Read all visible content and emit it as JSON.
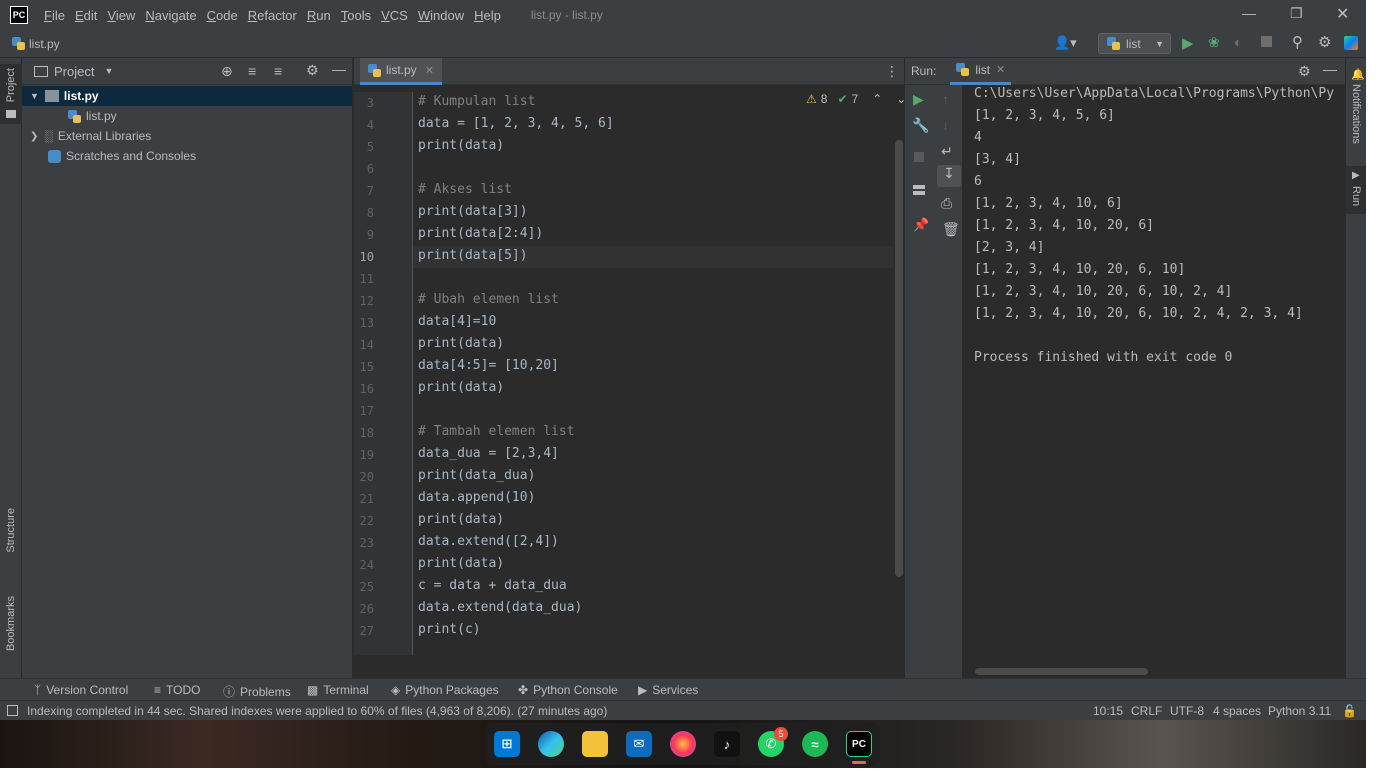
{
  "titlebar": {
    "menus": [
      "File",
      "Edit",
      "View",
      "Navigate",
      "Code",
      "Refactor",
      "Run",
      "Tools",
      "VCS",
      "Window",
      "Help"
    ],
    "window_title": "list.py - list.py"
  },
  "navbar": {
    "file": "list.py",
    "run_config": "list"
  },
  "left_stripe": {
    "project": "Project",
    "structure": "Structure",
    "bookmarks": "Bookmarks"
  },
  "project_panel": {
    "title": "Project",
    "tree": [
      {
        "label": "list.py",
        "selected": true
      },
      {
        "label": "list.py"
      },
      {
        "label": "External Libraries"
      },
      {
        "label": "Scratches and Consoles"
      }
    ]
  },
  "editor": {
    "tab": "list.py",
    "warnings": "8",
    "weak_warnings": "7",
    "current_line": 10,
    "lines": [
      {
        "n": "3",
        "text": "# Kumpulan list"
      },
      {
        "n": "4",
        "text": "data = [1, 2, 3, 4, 5, 6]"
      },
      {
        "n": "5",
        "text": "print(data)"
      },
      {
        "n": "6",
        "text": ""
      },
      {
        "n": "7",
        "text": "# Akses list"
      },
      {
        "n": "8",
        "text": "print(data[3])"
      },
      {
        "n": "9",
        "text": "print(data[2:4])"
      },
      {
        "n": "10",
        "text": "print(data[5])"
      },
      {
        "n": "11",
        "text": ""
      },
      {
        "n": "12",
        "text": "# Ubah elemen list"
      },
      {
        "n": "13",
        "text": "data[4]=10"
      },
      {
        "n": "14",
        "text": "print(data)"
      },
      {
        "n": "15",
        "text": "data[4:5]= [10,20]"
      },
      {
        "n": "16",
        "text": "print(data)"
      },
      {
        "n": "17",
        "text": ""
      },
      {
        "n": "18",
        "text": "# Tambah elemen list"
      },
      {
        "n": "19",
        "text": "data_dua = [2,3,4]"
      },
      {
        "n": "20",
        "text": "print(data_dua)"
      },
      {
        "n": "21",
        "text": "data.append(10)"
      },
      {
        "n": "22",
        "text": "print(data)"
      },
      {
        "n": "23",
        "text": "data.extend([2,4])"
      },
      {
        "n": "24",
        "text": "print(data)"
      },
      {
        "n": "25",
        "text": "c = data + data_dua"
      },
      {
        "n": "26",
        "text": "data.extend(data_dua)"
      },
      {
        "n": "27",
        "text": "print(c)"
      }
    ]
  },
  "run_panel": {
    "label": "Run:",
    "tab": "list",
    "output": [
      "C:\\Users\\User\\AppData\\Local\\Programs\\Python\\Py",
      "[1, 2, 3, 4, 5, 6]",
      "4",
      "[3, 4]",
      "6",
      "[1, 2, 3, 4, 10, 6]",
      "[1, 2, 3, 4, 10, 20, 6]",
      "[2, 3, 4]",
      "[1, 2, 3, 4, 10, 20, 6, 10]",
      "[1, 2, 3, 4, 10, 20, 6, 10, 2, 4]",
      "[1, 2, 3, 4, 10, 20, 6, 10, 2, 4, 2, 3, 4]",
      "",
      "Process finished with exit code 0"
    ]
  },
  "right_stripe": {
    "notifications": "Notifications",
    "run": "Run"
  },
  "bottom_tools": [
    "Version Control",
    "TODO",
    "Problems",
    "Terminal",
    "Python Packages",
    "Python Console",
    "Services"
  ],
  "status": {
    "message": "Indexing completed in 44 sec. Shared indexes were applied to 60% of files (4,963 of 8,206). (27 minutes ago)",
    "position": "10:15",
    "line_sep": "CRLF",
    "encoding": "UTF-8",
    "indent": "4 spaces",
    "interpreter": "Python 3.11"
  },
  "taskbar": {
    "whatsapp_badge": "5"
  }
}
